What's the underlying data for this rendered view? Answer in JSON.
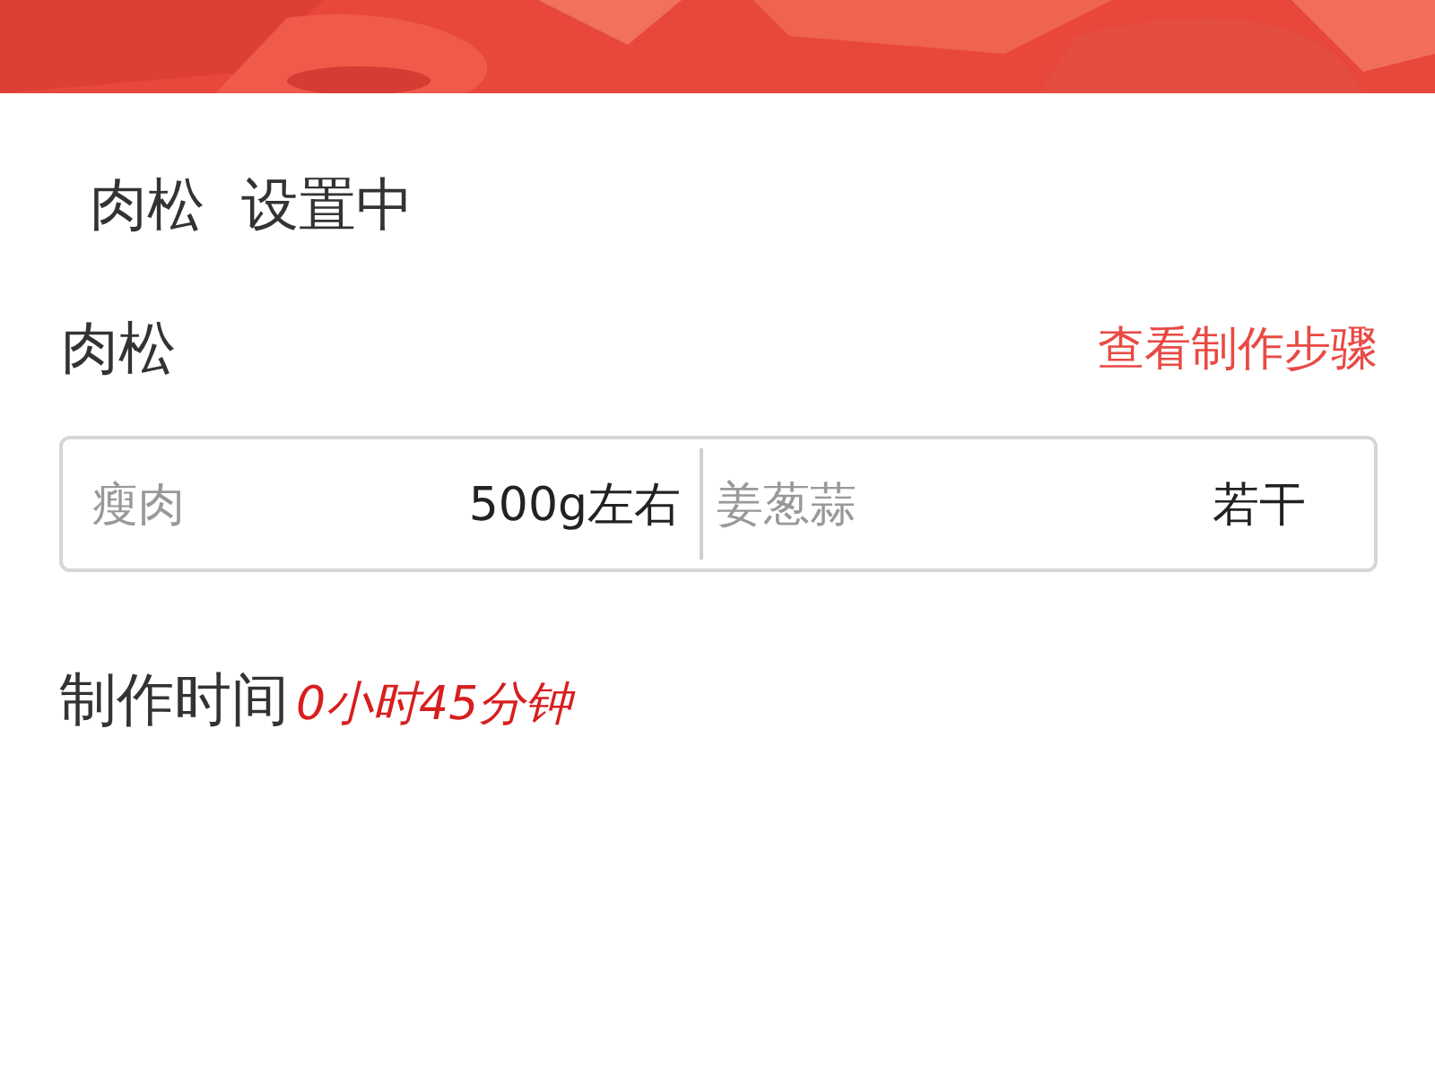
{
  "page_title": "肉松  设置中",
  "recipe": {
    "name": "肉松",
    "steps_link": "查看制作步骤"
  },
  "ingredients": [
    {
      "name": "瘦肉",
      "amount": "500g左右"
    },
    {
      "name": "姜葱蒜",
      "amount": "若干"
    }
  ],
  "cook_time": {
    "label": "制作时间",
    "value": "0小时45分钟"
  }
}
